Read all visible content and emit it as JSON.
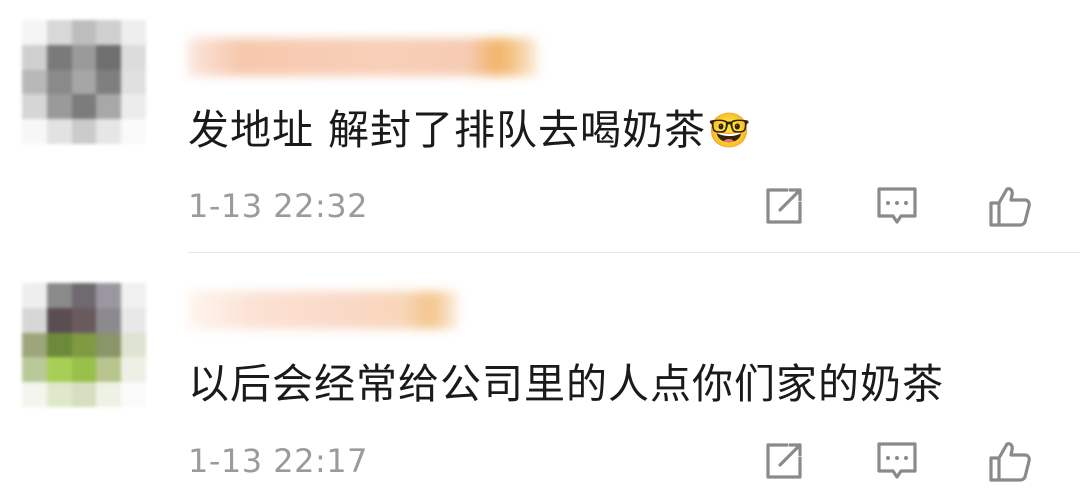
{
  "comments": [
    {
      "text": "发地址 解封了排队去喝奶茶",
      "emoji": "🤓",
      "timestamp": "1-13 22:32",
      "avatar_palette": [
        "#f5f5f5",
        "#d8d8d8",
        "#bdbdbd",
        "#cfcfcf",
        "#eeeeee",
        "#cfcfcf",
        "#7a7a7a",
        "#9a9a9a",
        "#6f6f6f",
        "#dcdcdc",
        "#b8b8b8",
        "#8a8a8a",
        "#a6a6a6",
        "#7f7f7f",
        "#e0e0e0",
        "#d6d6d6",
        "#9a9a9a",
        "#7c7c7c",
        "#a8a8a8",
        "#ececec",
        "#f7f7f7",
        "#e2e2e2",
        "#cbcbcb",
        "#e6e6e6",
        "#fafafa"
      ]
    },
    {
      "text": "以后会经常给公司里的人点你们家的奶茶",
      "emoji": "",
      "timestamp": "1-13 22:17",
      "avatar_palette": [
        "#eeeeee",
        "#8a8a8a",
        "#6e6a70",
        "#9b97a0",
        "#f0f0f0",
        "#d7d7d7",
        "#5b4e52",
        "#6a5a5e",
        "#8c8a8e",
        "#e8e8e8",
        "#9ca67a",
        "#6c8a3a",
        "#7f9a42",
        "#8a9568",
        "#dfe3d2",
        "#b9c99a",
        "#a8cf55",
        "#98c04a",
        "#b7c48e",
        "#eef0e6",
        "#f3f5ee",
        "#dfe8c9",
        "#d6dfc0",
        "#eef1e6",
        "#fbfbfb"
      ]
    }
  ],
  "actions": {
    "share_icon": "share-icon",
    "reply_icon": "comment-icon",
    "like_icon": "thumbs-up-icon"
  },
  "colors": {
    "text": "#1a1a1a",
    "timestamp": "#9b9b9b",
    "icon": "#8a8a8a",
    "divider": "#e8e8e8"
  }
}
